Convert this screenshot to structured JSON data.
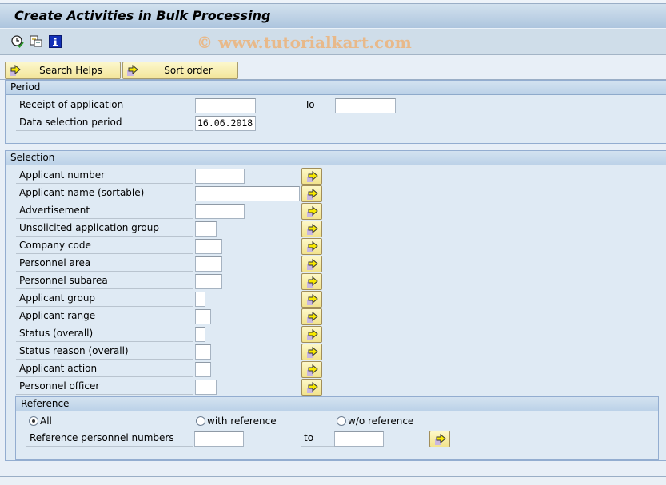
{
  "window": {
    "title": "Create Activities in Bulk Processing",
    "watermark": "© www.tutorialkart.com"
  },
  "toolbar": {
    "icons": [
      "execute-icon",
      "get-variant-icon",
      "info-icon"
    ]
  },
  "buttons": {
    "search_helps": "Search Helps",
    "sort_order": "Sort order"
  },
  "period": {
    "title": "Period",
    "receipt_label": "Receipt of application",
    "receipt_from": "",
    "to_label": "To",
    "receipt_to": "",
    "data_selection_label": "Data selection period",
    "data_selection_value": "16.06.2018"
  },
  "selection": {
    "title": "Selection",
    "fields": [
      {
        "label": "Applicant number",
        "value": ""
      },
      {
        "label": "Applicant name (sortable)",
        "value": ""
      },
      {
        "label": "Advertisement",
        "value": ""
      },
      {
        "label": "Unsolicited application group",
        "value": ""
      },
      {
        "label": "Company code",
        "value": ""
      },
      {
        "label": "Personnel area",
        "value": ""
      },
      {
        "label": "Personnel subarea",
        "value": ""
      },
      {
        "label": "Applicant group",
        "value": ""
      },
      {
        "label": "Applicant range",
        "value": ""
      },
      {
        "label": "Status (overall)",
        "value": ""
      },
      {
        "label": "Status reason (overall)",
        "value": ""
      },
      {
        "label": "Applicant action",
        "value": ""
      },
      {
        "label": "Personnel officer",
        "value": ""
      }
    ]
  },
  "reference": {
    "title": "Reference",
    "radio_all": "All",
    "radio_with": "with reference",
    "radio_without": "w/o reference",
    "selected": "All",
    "ref_label": "Reference personnel numbers",
    "ref_from": "",
    "to_label": "to",
    "ref_to": ""
  }
}
